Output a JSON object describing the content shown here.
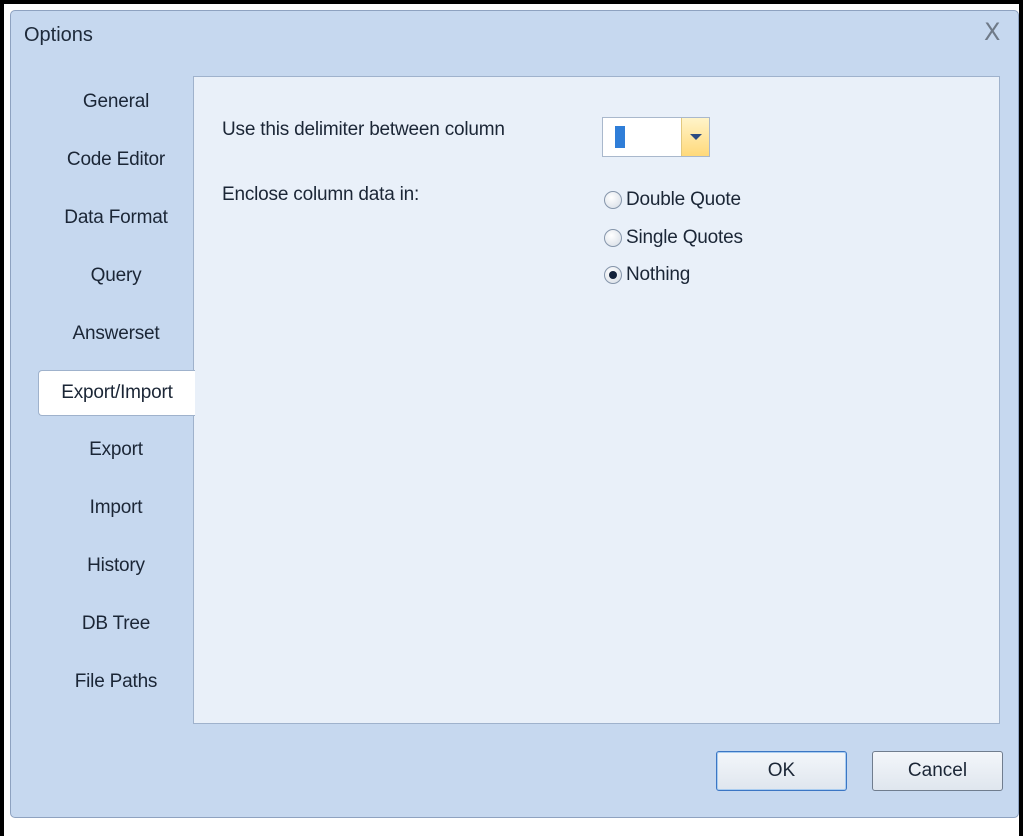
{
  "window": {
    "title": "Options",
    "close_glyph": "X"
  },
  "sidebar": {
    "items": [
      {
        "label": "General",
        "active": false
      },
      {
        "label": "Code Editor",
        "active": false
      },
      {
        "label": "Data Format",
        "active": false
      },
      {
        "label": "Query",
        "active": false
      },
      {
        "label": "Answerset",
        "active": false
      },
      {
        "label": "Export/Import",
        "active": true
      },
      {
        "label": "Export",
        "active": false
      },
      {
        "label": "Import",
        "active": false
      },
      {
        "label": "History",
        "active": false
      },
      {
        "label": "DB Tree",
        "active": false
      },
      {
        "label": "File Paths",
        "active": false
      }
    ]
  },
  "panel": {
    "delimiter_label": "Use this delimiter between column",
    "delimiter_value": "",
    "enclose_label": "Enclose column data in:",
    "enclose_options": [
      {
        "label": "Double Quote",
        "checked": false
      },
      {
        "label": "Single Quotes",
        "checked": false
      },
      {
        "label": "Nothing",
        "checked": true
      }
    ]
  },
  "buttons": {
    "ok": "OK",
    "cancel": "Cancel"
  },
  "colors": {
    "dialog_bg": "#c6d8ef",
    "panel_bg": "#e9f0f9",
    "selection": "#2f7ed8",
    "dropdown_button": "#ffd97a"
  }
}
